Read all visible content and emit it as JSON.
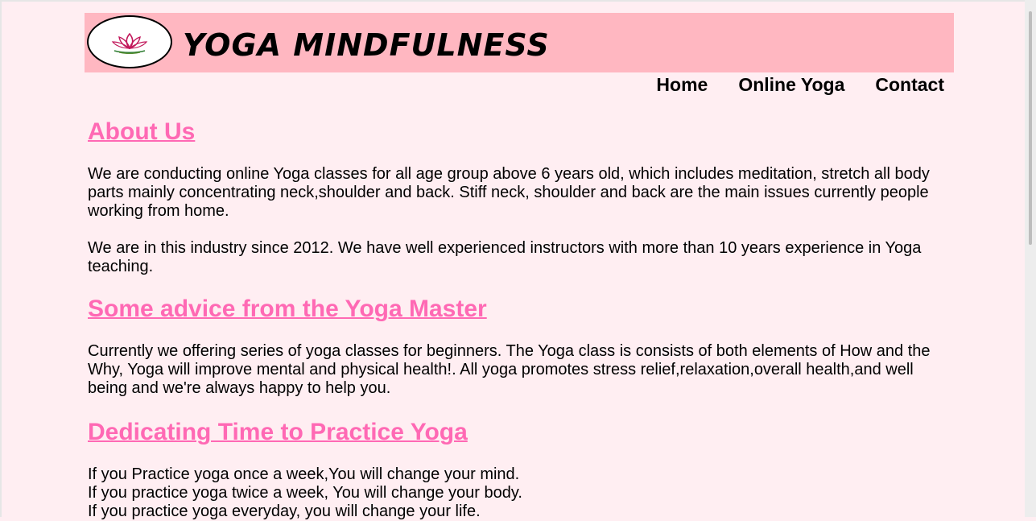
{
  "header": {
    "logo_name": "lotus-icon",
    "site_title": "YOGA MINDFULNESS",
    "colors": {
      "banner": "#ffb7c1",
      "page_background": "#ffeef2",
      "heading": "#ff69b4"
    }
  },
  "nav": {
    "items": [
      {
        "label": "Home"
      },
      {
        "label": "Online Yoga"
      },
      {
        "label": "Contact"
      }
    ]
  },
  "sections": [
    {
      "heading": "About Us",
      "paragraphs": [
        "We are conducting online Yoga classes for all age group above 6 years old, which includes meditation, stretch all body parts mainly concentrating neck,shoulder and back. Stiff neck, shoulder and back are the main issues currently people working from home.",
        "We are in this industry since 2012. We have well experienced instructors with more than 10 years experience in Yoga teaching."
      ]
    },
    {
      "heading": "Some advice from the Yoga Master",
      "paragraphs": [
        "Currently we offering series of yoga classes for beginners. The Yoga class is consists of both elements of How and the Why, Yoga will improve mental and physical health!. All yoga promotes stress relief,relaxation,overall health,and well being and we're always happy to help you."
      ]
    },
    {
      "heading": "Dedicating Time to Practice Yoga",
      "lines": [
        "If you Practice yoga once a week,You will change your mind.",
        "If you practice yoga twice a week, You will change your body.",
        "If you practice yoga everyday, you will change your life."
      ]
    }
  ]
}
